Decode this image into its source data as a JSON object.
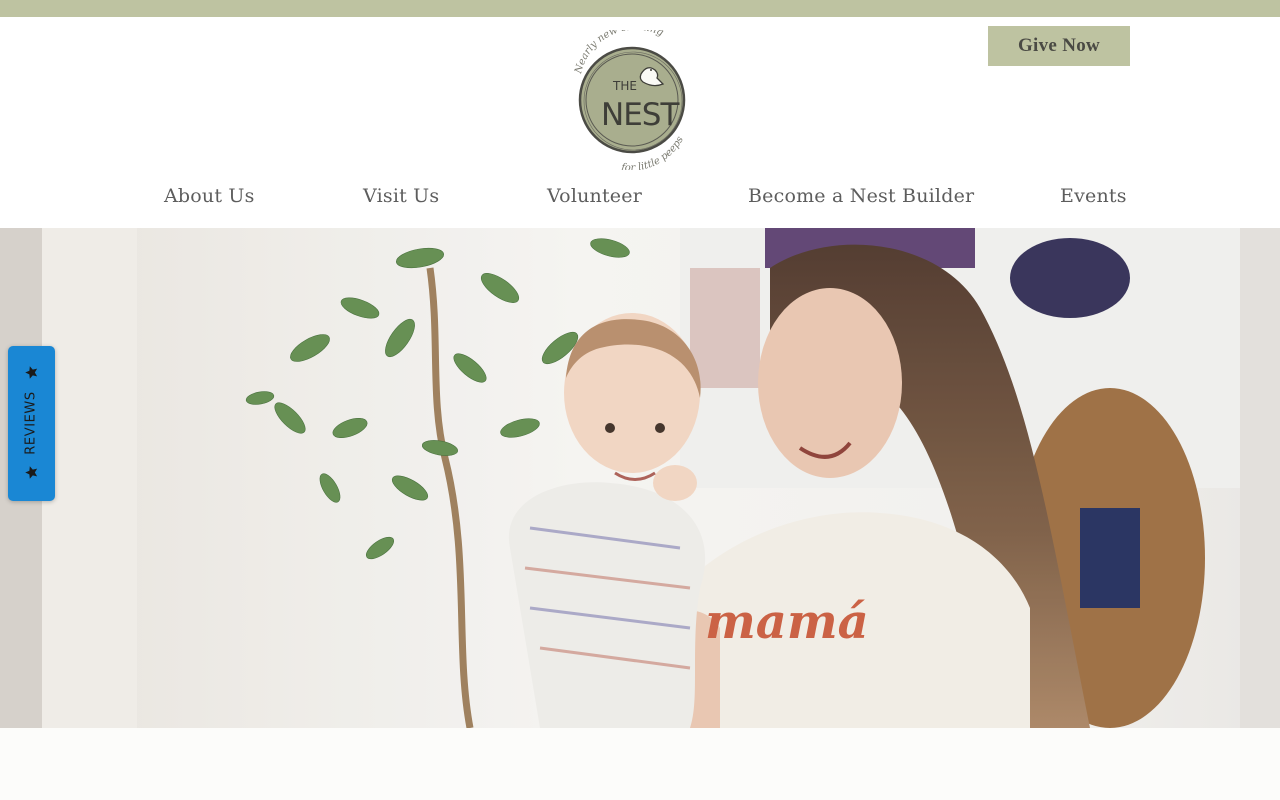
{
  "header": {
    "give_button": "Give Now",
    "logo": {
      "arc_top": "Nearly new clothing",
      "the": "THE",
      "nest": "NEST",
      "arc_bottom": "for little peeps"
    }
  },
  "nav": {
    "items": [
      {
        "label": "About Us"
      },
      {
        "label": "Visit Us"
      },
      {
        "label": "Volunteer"
      },
      {
        "label": "Become a Nest Builder"
      },
      {
        "label": "Events"
      }
    ]
  },
  "hero": {
    "shirt_text": "mamá"
  },
  "reviews_tab": {
    "label": "REVIEWS",
    "icon": "star-icon"
  },
  "colors": {
    "brand_sage": "#bec3a1",
    "logo_fill": "#a8ad8c",
    "reviews_blue": "#1a87d4",
    "nav_text": "#5d5d5d"
  }
}
